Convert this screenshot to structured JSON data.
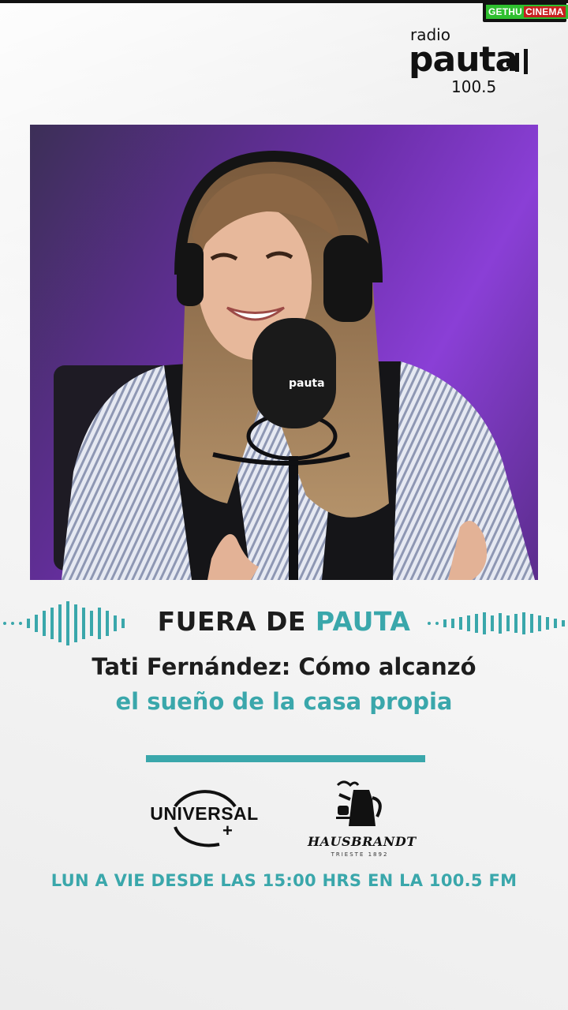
{
  "watermark": {
    "part1": "GETHU",
    "part2": "CINEMA"
  },
  "logo": {
    "radio": "radio",
    "brand": "pauta",
    "frequency": "100.5"
  },
  "mic_brand": "pauta",
  "headline": {
    "title_part1": "FUERA DE ",
    "title_part2": "PAUTA"
  },
  "subtitle": {
    "line1": "Tati Fernández: Cómo alcanzó",
    "line2": "el sueño de la casa propia"
  },
  "sponsors": {
    "universal": {
      "name": "UNIVERSAL",
      "plus": "+"
    },
    "hausbrandt": {
      "name": "HAUSBRANDT",
      "tagline": "TRIESTE 1892"
    }
  },
  "schedule": "LUN A VIE DESDE LAS 15:00 HRS EN LA 100.5 FM",
  "colors": {
    "accent": "#3aa7ab",
    "dark": "#1d1d1d",
    "studio_purple": "#7a38c4"
  }
}
